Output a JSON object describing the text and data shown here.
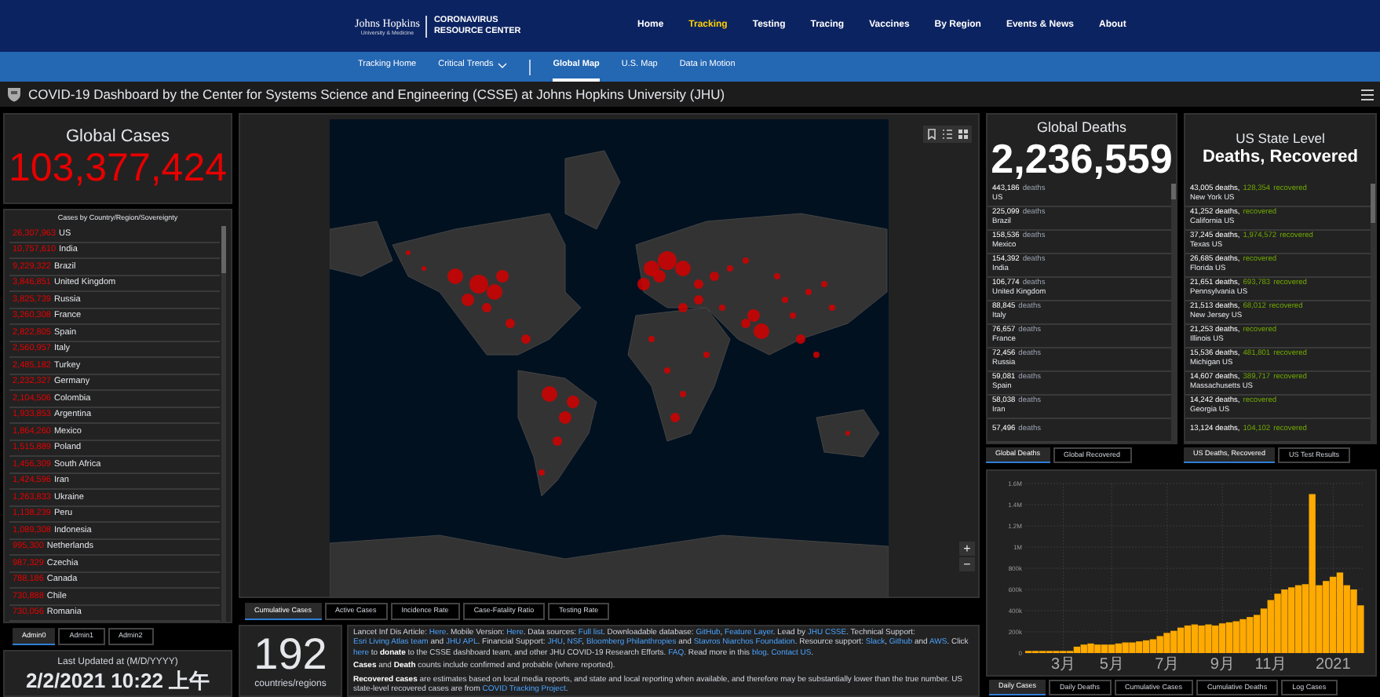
{
  "site_header": {
    "logo": {
      "line1": "Johns Hopkins",
      "line2": "University & Medicine",
      "line3": "CORONAVIRUS",
      "line4": "RESOURCE CENTER"
    },
    "nav": [
      {
        "label": "Home",
        "selected": false
      },
      {
        "label": "Tracking",
        "selected": true
      },
      {
        "label": "Testing",
        "selected": false
      },
      {
        "label": "Tracing",
        "selected": false
      },
      {
        "label": "Vaccines",
        "selected": false
      },
      {
        "label": "By Region",
        "selected": false
      },
      {
        "label": "Events & News",
        "selected": false
      },
      {
        "label": "About",
        "selected": false
      }
    ],
    "subnav": [
      {
        "label": "Tracking Home",
        "selected": false,
        "dropdown": false
      },
      {
        "label": "Critical Trends",
        "selected": false,
        "dropdown": true
      },
      {
        "label": "Global Map",
        "selected": true,
        "dropdown": false
      },
      {
        "label": "U.S. Map",
        "selected": false,
        "dropdown": false
      },
      {
        "label": "Data in Motion",
        "selected": false,
        "dropdown": false
      }
    ]
  },
  "dashboard_title": "COVID-19 Dashboard by the Center for Systems Science and Engineering (CSSE) at Johns Hopkins University (JHU)",
  "global_cases": {
    "title": "Global Cases",
    "value": "103,377,424"
  },
  "cases_list": {
    "title": "Cases by Country/Region/Sovereignty",
    "rows": [
      {
        "count": "26,307,963",
        "place": "US"
      },
      {
        "count": "10,757,610",
        "place": "India"
      },
      {
        "count": "9,229,322",
        "place": "Brazil"
      },
      {
        "count": "3,846,851",
        "place": "United Kingdom"
      },
      {
        "count": "3,825,739",
        "place": "Russia"
      },
      {
        "count": "3,260,308",
        "place": "France"
      },
      {
        "count": "2,822,805",
        "place": "Spain"
      },
      {
        "count": "2,560,957",
        "place": "Italy"
      },
      {
        "count": "2,485,182",
        "place": "Turkey"
      },
      {
        "count": "2,232,327",
        "place": "Germany"
      },
      {
        "count": "2,104,506",
        "place": "Colombia"
      },
      {
        "count": "1,933,853",
        "place": "Argentina"
      },
      {
        "count": "1,864,260",
        "place": "Mexico"
      },
      {
        "count": "1,515,889",
        "place": "Poland"
      },
      {
        "count": "1,456,309",
        "place": "South Africa"
      },
      {
        "count": "1,424,596",
        "place": "Iran"
      },
      {
        "count": "1,263,833",
        "place": "Ukraine"
      },
      {
        "count": "1,138,239",
        "place": "Peru"
      },
      {
        "count": "1,089,308",
        "place": "Indonesia"
      },
      {
        "count": "995,300",
        "place": "Netherlands"
      },
      {
        "count": "987,329",
        "place": "Czechia"
      },
      {
        "count": "788,186",
        "place": "Canada"
      },
      {
        "count": "730,888",
        "place": "Chile"
      },
      {
        "count": "730,056",
        "place": "Romania"
      }
    ],
    "tabs": [
      {
        "label": "Admin0",
        "selected": true
      },
      {
        "label": "Admin1",
        "selected": false
      },
      {
        "label": "Admin2",
        "selected": false
      }
    ]
  },
  "last_updated": {
    "label": "Last Updated at (M/D/YYYY)",
    "value": "2/2/2021 10:22 上午"
  },
  "map": {
    "zoom_in": "+",
    "zoom_out": "−",
    "tabs": [
      {
        "label": "Cumulative Cases",
        "selected": true
      },
      {
        "label": "Active Cases",
        "selected": false
      },
      {
        "label": "Incidence Rate",
        "selected": false
      },
      {
        "label": "Case-Fatality Ratio",
        "selected": false
      },
      {
        "label": "Testing Rate",
        "selected": false
      }
    ]
  },
  "countries": {
    "value": "192",
    "label": "countries/regions"
  },
  "info": [
    [
      {
        "kind": "text",
        "text": "Lancet Inf Dis Article: "
      },
      {
        "kind": "link",
        "text": "Here"
      },
      {
        "kind": "text",
        "text": ". Mobile Version: "
      },
      {
        "kind": "link",
        "text": "Here"
      },
      {
        "kind": "text",
        "text": ". Data sources: "
      },
      {
        "kind": "link",
        "text": "Full list"
      },
      {
        "kind": "text",
        "text": ". Downloadable database: "
      },
      {
        "kind": "link",
        "text": "GitHub"
      },
      {
        "kind": "text",
        "text": ", "
      },
      {
        "kind": "link",
        "text": "Feature Layer"
      },
      {
        "kind": "text",
        "text": ". Lead by "
      },
      {
        "kind": "link",
        "text": "JHU CSSE"
      },
      {
        "kind": "text",
        "text": ". Technical Support: "
      },
      {
        "kind": "link",
        "text": "Esri Living Atlas team"
      },
      {
        "kind": "text",
        "text": " and "
      },
      {
        "kind": "link",
        "text": "JHU APL"
      },
      {
        "kind": "text",
        "text": ". Financial Support: "
      },
      {
        "kind": "link",
        "text": "JHU"
      },
      {
        "kind": "text",
        "text": ", "
      },
      {
        "kind": "link",
        "text": "NSF"
      },
      {
        "kind": "text",
        "text": ", "
      },
      {
        "kind": "link",
        "text": "Bloomberg Philanthropies"
      },
      {
        "kind": "text",
        "text": " and "
      },
      {
        "kind": "link",
        "text": "Stavros Niarchos Foundation"
      },
      {
        "kind": "text",
        "text": ". Resource support: "
      },
      {
        "kind": "link",
        "text": "Slack"
      },
      {
        "kind": "text",
        "text": ", "
      },
      {
        "kind": "link",
        "text": "Github"
      },
      {
        "kind": "text",
        "text": " and "
      },
      {
        "kind": "link",
        "text": "AWS"
      },
      {
        "kind": "text",
        "text": ". Click "
      },
      {
        "kind": "link",
        "text": "here"
      },
      {
        "kind": "text",
        "text": " to "
      },
      {
        "kind": "bold",
        "text": "donate"
      },
      {
        "kind": "text",
        "text": " to the CSSE dashboard team, and other JHU COVID-19 Research Efforts. "
      },
      {
        "kind": "link",
        "text": "FAQ"
      },
      {
        "kind": "text",
        "text": ". Read more in this "
      },
      {
        "kind": "link",
        "text": "blog"
      },
      {
        "kind": "text",
        "text": ". "
      },
      {
        "kind": "link",
        "text": "Contact US"
      },
      {
        "kind": "text",
        "text": "."
      }
    ],
    [
      {
        "kind": "bold",
        "text": "Cases"
      },
      {
        "kind": "text",
        "text": " and "
      },
      {
        "kind": "bold",
        "text": "Death"
      },
      {
        "kind": "text",
        "text": " counts include confirmed and probable (where reported)."
      }
    ],
    [
      {
        "kind": "bold",
        "text": "Recovered cases"
      },
      {
        "kind": "text",
        "text": " are estimates based on local media reports, and state and local reporting when available, and therefore may be substantially lower than the true number. US state-level recovered cases are from "
      },
      {
        "kind": "link",
        "text": "COVID Tracking Project"
      },
      {
        "kind": "text",
        "text": "."
      }
    ]
  ],
  "global_deaths": {
    "title": "Global Deaths",
    "value": "2,236,559",
    "rows": [
      {
        "count": "443,186",
        "unit": "deaths",
        "place": "US"
      },
      {
        "count": "225,099",
        "unit": "deaths",
        "place": "Brazil"
      },
      {
        "count": "158,536",
        "unit": "deaths",
        "place": "Mexico"
      },
      {
        "count": "154,392",
        "unit": "deaths",
        "place": "India"
      },
      {
        "count": "106,774",
        "unit": "deaths",
        "place": "United Kingdom"
      },
      {
        "count": "88,845",
        "unit": "deaths",
        "place": "Italy"
      },
      {
        "count": "76,657",
        "unit": "deaths",
        "place": "France"
      },
      {
        "count": "72,456",
        "unit": "deaths",
        "place": "Russia"
      },
      {
        "count": "59,081",
        "unit": "deaths",
        "place": "Spain"
      },
      {
        "count": "58,038",
        "unit": "deaths",
        "place": "Iran"
      },
      {
        "count": "57,496",
        "unit": "deaths"
      }
    ],
    "tabs": [
      {
        "label": "Global Deaths",
        "selected": true
      },
      {
        "label": "Global Recovered",
        "selected": false
      }
    ]
  },
  "us_state": {
    "title": "US State Level",
    "subtitle": "Deaths, Recovered",
    "rows": [
      {
        "deaths": "43,005",
        "deaths_unit": "deaths,",
        "recovered": "128,354",
        "recovered_unit": "recovered",
        "place": "New York US"
      },
      {
        "deaths": "41,252",
        "deaths_unit": "deaths,",
        "recovered_unit": "recovered",
        "place": "California US"
      },
      {
        "deaths": "37,245",
        "deaths_unit": "deaths,",
        "recovered": "1,974,572",
        "recovered_unit": "recovered",
        "place": "Texas US"
      },
      {
        "deaths": "26,685",
        "deaths_unit": "deaths,",
        "recovered_unit": "recovered",
        "place": "Florida US"
      },
      {
        "deaths": "21,651",
        "deaths_unit": "deaths,",
        "recovered": "693,783",
        "recovered_unit": "recovered",
        "place": "Pennsylvania US"
      },
      {
        "deaths": "21,513",
        "deaths_unit": "deaths,",
        "recovered": "68,012",
        "recovered_unit": "recovered",
        "place": "New Jersey US"
      },
      {
        "deaths": "21,253",
        "deaths_unit": "deaths,",
        "recovered_unit": "recovered",
        "place": "Illinois US"
      },
      {
        "deaths": "15,536",
        "deaths_unit": "deaths,",
        "recovered": "481,801",
        "recovered_unit": "recovered",
        "place": "Michigan US"
      },
      {
        "deaths": "14,607",
        "deaths_unit": "deaths,",
        "recovered": "389,717",
        "recovered_unit": "recovered",
        "place": "Massachusetts US"
      },
      {
        "deaths": "14,242",
        "deaths_unit": "deaths,",
        "recovered_unit": "recovered",
        "place": "Georgia US"
      },
      {
        "deaths": "13,124",
        "deaths_unit": "deaths,",
        "recovered": "104,102",
        "recovered_unit": "recovered"
      }
    ],
    "tabs": [
      {
        "label": "US Deaths, Recovered",
        "selected": true
      },
      {
        "label": "US Test Results",
        "selected": false
      }
    ]
  },
  "daily_chart": {
    "chart_data": {
      "type": "bar",
      "categories": [
        null,
        null,
        null,
        null,
        null,
        "3月",
        null,
        null,
        null,
        null,
        null,
        null,
        "5月",
        null,
        null,
        null,
        null,
        null,
        null,
        null,
        "7月",
        null,
        null,
        null,
        null,
        null,
        null,
        null,
        "9月",
        null,
        null,
        null,
        null,
        null,
        null,
        "11月",
        null,
        null,
        null,
        null,
        null,
        null,
        null,
        null,
        "2021",
        null,
        null,
        null,
        null
      ],
      "series": [
        {
          "color": "#ffaa00",
          "values": [
            20000,
            20000,
            20000,
            20000,
            20000,
            20000,
            20000,
            60000,
            80000,
            90000,
            80000,
            80000,
            80000,
            90000,
            100000,
            100000,
            110000,
            120000,
            130000,
            160000,
            190000,
            210000,
            240000,
            260000,
            270000,
            260000,
            270000,
            260000,
            280000,
            290000,
            300000,
            320000,
            340000,
            360000,
            420000,
            500000,
            560000,
            600000,
            620000,
            640000,
            650000,
            1500000,
            640000,
            680000,
            720000,
            760000,
            640000,
            600000,
            450000
          ]
        }
      ],
      "ylim": [
        0,
        1600000
      ],
      "grid": true,
      "yticks": [
        {
          "value": 0,
          "label": "0"
        },
        {
          "value": 200000,
          "label": "200k"
        },
        {
          "value": 400000,
          "label": "400k"
        },
        {
          "value": 600000,
          "label": "600k"
        },
        {
          "value": 800000,
          "label": "800k"
        },
        {
          "value": 1000000,
          "label": "1M"
        },
        {
          "value": 1200000,
          "label": "1.2M"
        },
        {
          "value": 1400000,
          "label": "1.4M"
        },
        {
          "value": 1600000,
          "label": "1.6M"
        }
      ]
    },
    "tabs": [
      {
        "label": "Daily Cases",
        "selected": true
      },
      {
        "label": "Daily Deaths",
        "selected": false
      },
      {
        "label": "Cumulative Cases",
        "selected": false
      },
      {
        "label": "Cumulative Deaths",
        "selected": false
      },
      {
        "label": "Log Cases",
        "selected": false
      }
    ]
  }
}
